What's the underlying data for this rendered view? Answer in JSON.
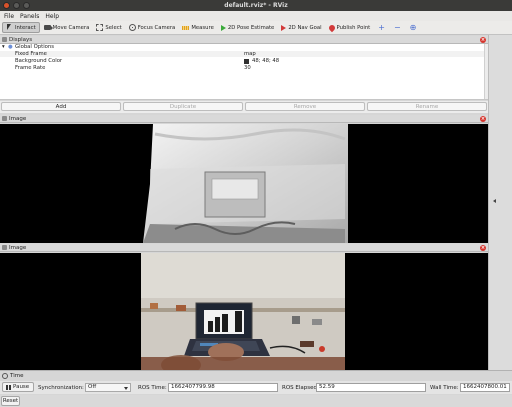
{
  "window": {
    "title": "default.rviz* - RViz"
  },
  "menu": [
    "File",
    "Panels",
    "Help"
  ],
  "toolbar": {
    "items": [
      {
        "label": "Interact",
        "icon": "cursor-icon",
        "active": true
      },
      {
        "label": "Move Camera",
        "icon": "camera-icon"
      },
      {
        "label": "Select",
        "icon": "select-box-icon"
      },
      {
        "label": "Focus Camera",
        "icon": "target-icon"
      },
      {
        "label": "Measure",
        "icon": "ruler-icon"
      },
      {
        "label": "2D Pose Estimate",
        "icon": "green-arrow-icon"
      },
      {
        "label": "2D Nav Goal",
        "icon": "red-arrow-icon"
      },
      {
        "label": "Publish Point",
        "icon": "pin-icon"
      }
    ],
    "extra_icons": [
      "+",
      "−",
      "⊕"
    ]
  },
  "displays": {
    "title": "Displays",
    "rows": [
      {
        "label": "Global Options",
        "value": ""
      },
      {
        "label": "Fixed Frame",
        "value": "map"
      },
      {
        "label": "Background Color",
        "value": "48; 48; 48",
        "color": "#303030"
      },
      {
        "label": "Frame Rate",
        "value": "30"
      }
    ],
    "buttons": [
      {
        "label": "Add",
        "enabled": true
      },
      {
        "label": "Duplicate",
        "enabled": false
      },
      {
        "label": "Remove",
        "enabled": false
      },
      {
        "label": "Rename",
        "enabled": false
      }
    ]
  },
  "image_panels": [
    {
      "title": "Image"
    },
    {
      "title": "Image"
    }
  ],
  "time": {
    "title": "Time",
    "pause_label": "Pause",
    "sync_label": "Synchronization:",
    "sync_value": "Off",
    "ros_time_label": "ROS Time:",
    "ros_time": "1662407799.98",
    "ros_elapsed_label": "ROS Elapsed:",
    "ros_elapsed": "52.59",
    "wall_time_label": "Wall Time:",
    "wall_time": "1662407800.01",
    "reset_label": "Reset"
  }
}
